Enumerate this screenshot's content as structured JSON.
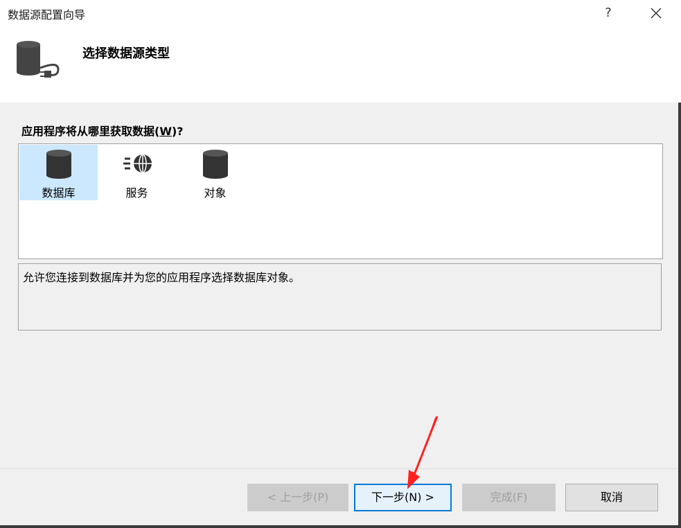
{
  "window": {
    "title": "数据源配置向导",
    "help_label": "?"
  },
  "header": {
    "title": "选择数据源类型",
    "icon": "database-plug-icon"
  },
  "main": {
    "question": "应用程序将从哪里获取数据(W)?",
    "question_prefix": "应用程序将从哪里获取数据(",
    "question_mnemonic": "W",
    "question_suffix": ")?",
    "sources": [
      {
        "label": "数据库",
        "icon": "database-icon",
        "selected": true
      },
      {
        "label": "服务",
        "icon": "service-globe-icon",
        "selected": false
      },
      {
        "label": "对象",
        "icon": "object-icon",
        "selected": false
      }
    ],
    "description": "允许您连接到数据库并为您的应用程序选择数据库对象。"
  },
  "footer": {
    "back_label": "< 上一步(P)",
    "next_label": "下一步(N) >",
    "finish_label": "完成(F)",
    "cancel_label": "取消"
  },
  "colors": {
    "accent": "#0078d7",
    "selection": "#cce8ff",
    "annotation_arrow": "#ff2020"
  }
}
